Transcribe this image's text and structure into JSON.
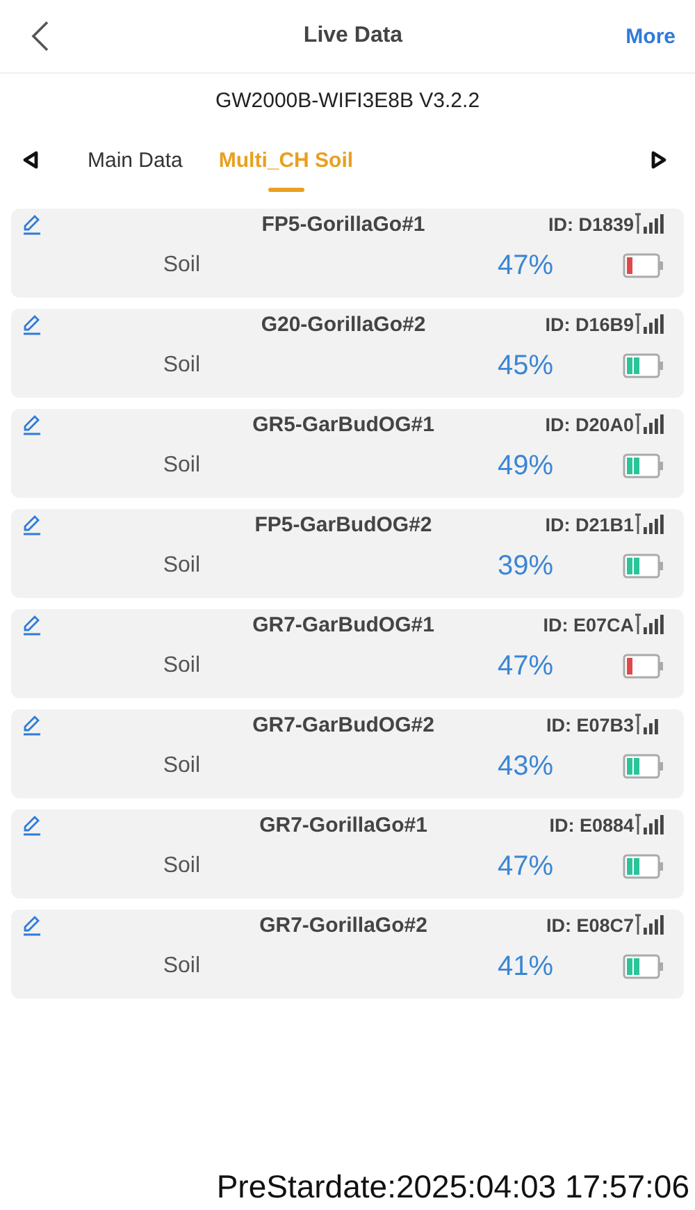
{
  "header": {
    "title": "Live Data",
    "action": "More"
  },
  "device": "GW2000B-WIFI3E8B V3.2.2",
  "tabs": [
    {
      "label": "Main Data",
      "selected": false
    },
    {
      "label": "Multi_CH Soil",
      "selected": true
    }
  ],
  "sensors": [
    {
      "name": "FP5-GorillaGo#1",
      "id": "ID: D1839",
      "label": "Soil",
      "value": "47%",
      "battery_low": true,
      "signal_weak": false
    },
    {
      "name": "G20-GorillaGo#2",
      "id": "ID: D16B9",
      "label": "Soil",
      "value": "45%",
      "battery_low": false,
      "signal_weak": false
    },
    {
      "name": "GR5-GarBudOG#1",
      "id": "ID: D20A0",
      "label": "Soil",
      "value": "49%",
      "battery_low": false,
      "signal_weak": false
    },
    {
      "name": "FP5-GarBudOG#2",
      "id": "ID: D21B1",
      "label": "Soil",
      "value": "39%",
      "battery_low": false,
      "signal_weak": false
    },
    {
      "name": "GR7-GarBudOG#1",
      "id": "ID: E07CA",
      "label": "Soil",
      "value": "47%",
      "battery_low": true,
      "signal_weak": false
    },
    {
      "name": "GR7-GarBudOG#2",
      "id": "ID: E07B3",
      "label": "Soil",
      "value": "43%",
      "battery_low": false,
      "signal_weak": true
    },
    {
      "name": "GR7-GorillaGo#1",
      "id": "ID: E0884",
      "label": "Soil",
      "value": "47%",
      "battery_low": false,
      "signal_weak": false
    },
    {
      "name": "GR7-GorillaGo#2",
      "id": "ID: E08C7",
      "label": "Soil",
      "value": "41%",
      "battery_low": false,
      "signal_weak": false
    }
  ],
  "timestamp": "PreStardate:2025:04:03 17:57:06"
}
